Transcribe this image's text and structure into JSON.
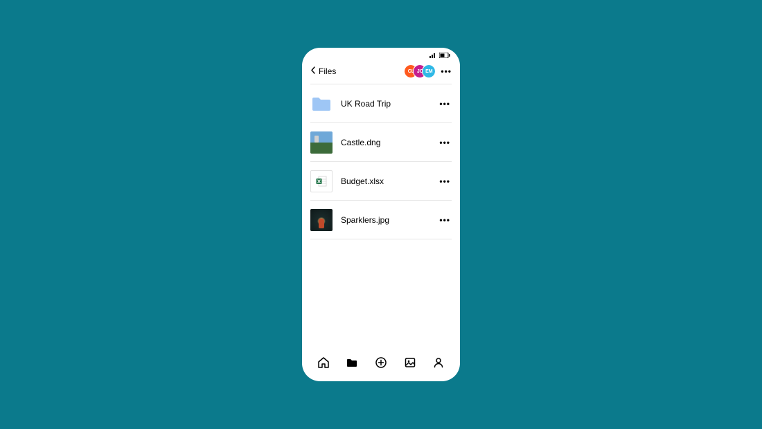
{
  "header": {
    "back_label": "Files"
  },
  "avatars": [
    {
      "initials": "CL",
      "color": "#ff5a1f"
    },
    {
      "initials": "JC",
      "color": "#c41e8e"
    },
    {
      "initials": "EM",
      "color": "#2fb8e6"
    }
  ],
  "files": [
    {
      "name": "UK Road Trip",
      "kind": "folder"
    },
    {
      "name": "Castle.dng",
      "kind": "image-castle"
    },
    {
      "name": "Budget.xlsx",
      "kind": "xlsx"
    },
    {
      "name": "Sparklers.jpg",
      "kind": "image-sparklers"
    }
  ],
  "glyphs": {
    "more": "•••"
  }
}
